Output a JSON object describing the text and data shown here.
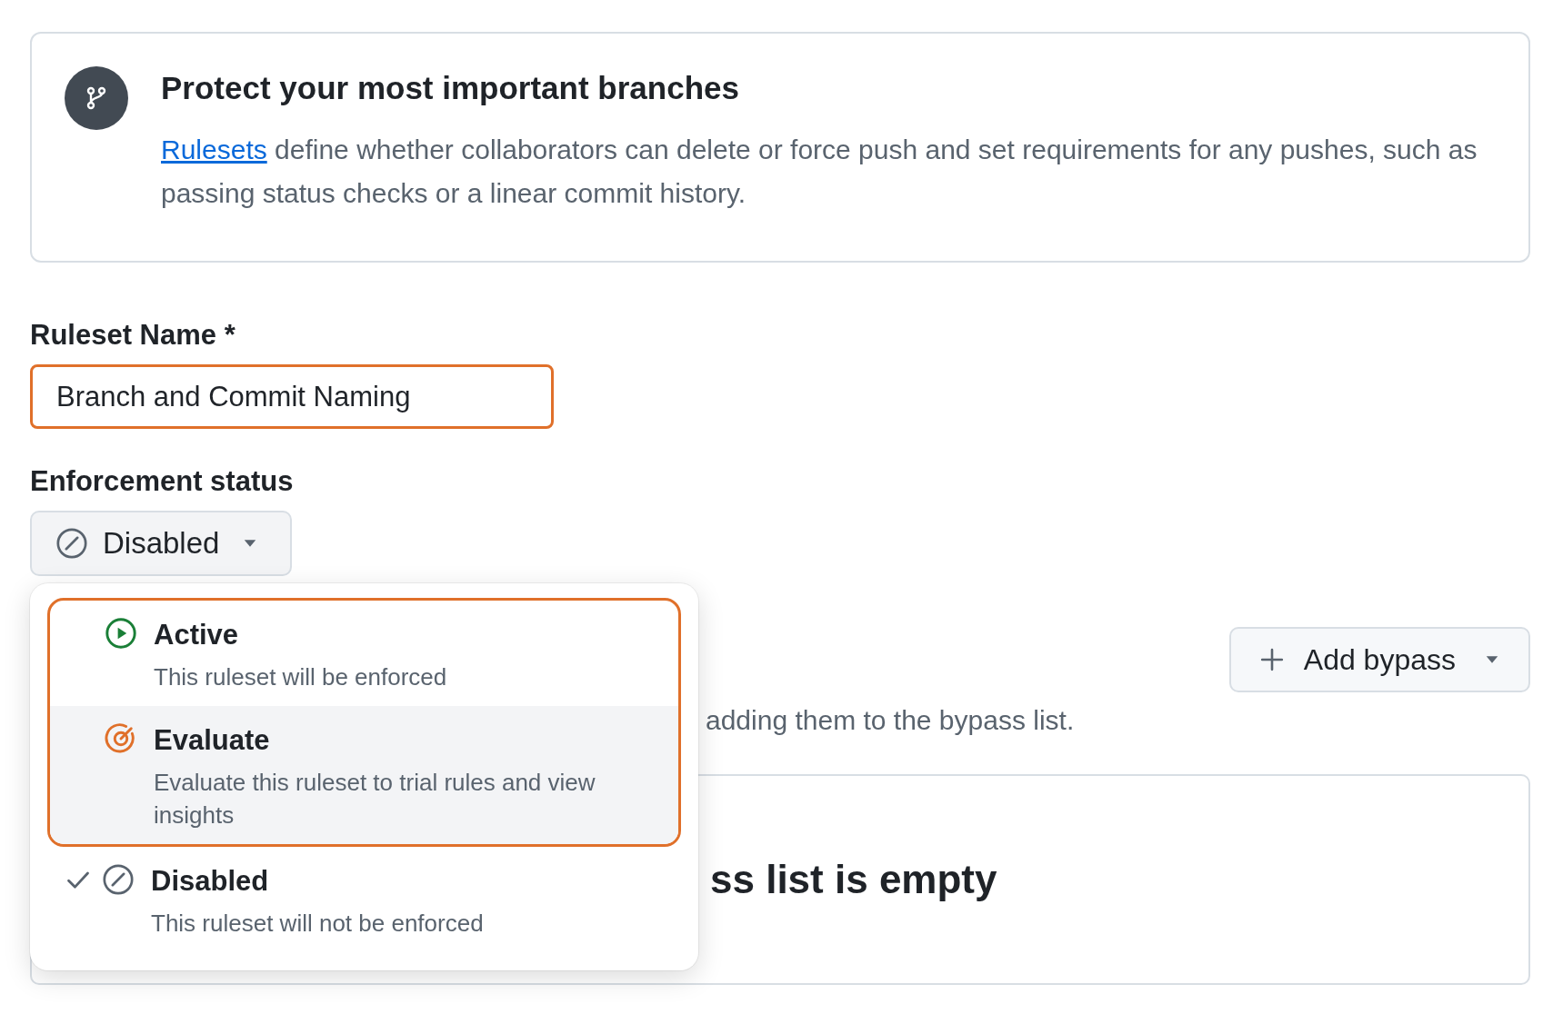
{
  "banner": {
    "title": "Protect your most important branches",
    "link": "Rulesets",
    "text": " define whether collaborators can delete or force push and set requirements for any pushes, such as passing status checks or a linear commit history."
  },
  "name_field": {
    "label": "Ruleset Name *",
    "value": "Branch and Commit Naming",
    "annotated": true
  },
  "enforcement": {
    "label": "Enforcement status",
    "button": {
      "label": "Disabled",
      "kind": "disabled"
    },
    "menu": [
      {
        "kind": "active",
        "title": "Active",
        "description": "This ruleset will be enforced",
        "selected": false,
        "hovered": false,
        "annotated": true
      },
      {
        "kind": "evaluate",
        "title": "Evaluate",
        "description": "Evaluate this ruleset to trial rules and view insights",
        "selected": false,
        "hovered": true,
        "annotated": true
      },
      {
        "kind": "disabled",
        "title": "Disabled",
        "description": "This ruleset will not be enforced",
        "selected": true,
        "hovered": false,
        "annotated": false
      }
    ]
  },
  "bypass": {
    "button": "Add bypass",
    "text": "adding them to the bypass list.",
    "empty_title": "ss list is empty"
  }
}
